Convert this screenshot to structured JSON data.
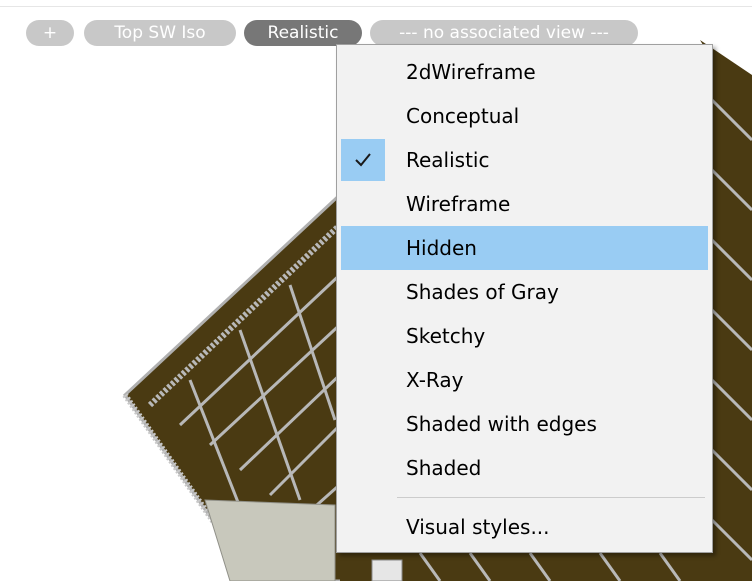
{
  "viewport_controls": {
    "plus_label": "+",
    "view_label": "Top SW Iso",
    "visual_style_label": "Realistic",
    "ucs_label": "--- no associated view ---"
  },
  "visual_style_menu": {
    "selected": "Realistic",
    "highlighted": "Hidden",
    "items": [
      {
        "label": "2dWireframe"
      },
      {
        "label": "Conceptual"
      },
      {
        "label": "Realistic"
      },
      {
        "label": "Wireframe"
      },
      {
        "label": "Hidden"
      },
      {
        "label": "Shades of Gray"
      },
      {
        "label": "Sketchy"
      },
      {
        "label": "X-Ray"
      },
      {
        "label": "Shaded with edges"
      },
      {
        "label": "Shaded"
      }
    ],
    "footer_item": "Visual styles..."
  },
  "colors": {
    "roof_fill": "#4a3a12",
    "roof_frame": "#b8b8b8",
    "menu_background": "#f2f2f2",
    "menu_highlight": "#99ccf3"
  }
}
